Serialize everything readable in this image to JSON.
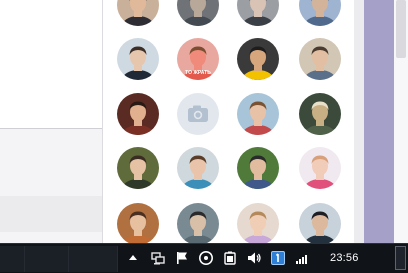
{
  "avatars": [
    {
      "id": "r0c0",
      "kind": "photo",
      "bg": "#c9b09a",
      "skin": "#e0b99a",
      "hair": "#3a2a22",
      "shirt": "#2d2d33"
    },
    {
      "id": "r0c1",
      "kind": "photo",
      "bg": "#6f7378",
      "skin": "#b8a89a",
      "hair": "#2c2c2c",
      "shirt": "#444a52"
    },
    {
      "id": "r0c2",
      "kind": "photo",
      "bg": "#9b9ea3",
      "skin": "#d8c3b5",
      "hair": "#2a2320",
      "shirt": "#3b3f46"
    },
    {
      "id": "r0c3",
      "kind": "photo",
      "bg": "#9fb4d0",
      "skin": "#d4b39b",
      "hair": "#3a2a20",
      "shirt": "#4f6a8c"
    },
    {
      "id": "r1c0",
      "kind": "photo",
      "bg": "#cfd9e2",
      "skin": "#e6c7ad",
      "hair": "#3b2f28",
      "shirt": "#1f2a36"
    },
    {
      "id": "r1c1",
      "kind": "photo",
      "bg": "#e8a8a0",
      "skin": "#f08a7a",
      "hair": "#7a4e30",
      "shirt": "#e35a4d",
      "caption": "ТО ЖРАТЬ"
    },
    {
      "id": "r1c2",
      "kind": "photo",
      "bg": "#3a3a3a",
      "skin": "#d6a77c",
      "hair": "#1d1d1d",
      "shirt": "#f2c200"
    },
    {
      "id": "r1c3",
      "kind": "photo",
      "bg": "#d2c6b5",
      "skin": "#e2bfa2",
      "hair": "#4a3b30",
      "shirt": "#5a6f8a"
    },
    {
      "id": "r2c0",
      "kind": "photo",
      "bg": "#5a2b22",
      "skin": "#e0b08f",
      "hair": "#2a1a14",
      "shirt": "#7a2f24"
    },
    {
      "id": "r2c1",
      "kind": "camera",
      "bg": "#e2e7ee",
      "icon": "camera-icon"
    },
    {
      "id": "r2c2",
      "kind": "photo",
      "bg": "#a8c4d8",
      "skin": "#e8c2a6",
      "hair": "#7a5232",
      "shirt": "#c24a4a"
    },
    {
      "id": "r2c3",
      "kind": "photo",
      "bg": "#3b4a3a",
      "skin": "#c9b084",
      "hair": "#e9e0c8",
      "shirt": "#50614a"
    },
    {
      "id": "r3c0",
      "kind": "photo",
      "bg": "#5f6b3a",
      "skin": "#e6c2a4",
      "hair": "#3a2c22",
      "shirt": "#2f3a2a"
    },
    {
      "id": "r3c1",
      "kind": "photo",
      "bg": "#cfd8dd",
      "skin": "#e9c4ab",
      "hair": "#5a3e2a",
      "shirt": "#3c8fb8"
    },
    {
      "id": "r3c2",
      "kind": "photo",
      "bg": "#4f7a3a",
      "skin": "#e2bc9f",
      "hair": "#2a2a2a",
      "shirt": "#3f5a8a"
    },
    {
      "id": "r3c3",
      "kind": "photo",
      "bg": "#f1e9f0",
      "skin": "#f0ccb9",
      "hair": "#d8a07a",
      "shirt": "#e0507a"
    },
    {
      "id": "r4c0",
      "kind": "photo",
      "bg": "#b07040",
      "skin": "#e7c0a0",
      "hair": "#4a3020",
      "shirt": "#c06c34"
    },
    {
      "id": "r4c1",
      "kind": "photo",
      "bg": "#7a8a92",
      "skin": "#d8c0a8",
      "hair": "#2a2a2a",
      "shirt": "#5a6a72"
    },
    {
      "id": "r4c2",
      "kind": "photo",
      "bg": "#e6d9cf",
      "skin": "#f0cdb5",
      "hair": "#b48a5a",
      "shirt": "#c8a8d8"
    },
    {
      "id": "r4c3",
      "kind": "photo",
      "bg": "#c8d2da",
      "skin": "#dcb89c",
      "hair": "#1e1e22",
      "shirt": "#23303e"
    }
  ],
  "taskbar": {
    "clock": "23:56",
    "tray_icons": [
      "network-icon",
      "flag-icon",
      "info-icon",
      "battery-icon",
      "speaker-icon",
      "language-icon",
      "signal-icon"
    ]
  }
}
